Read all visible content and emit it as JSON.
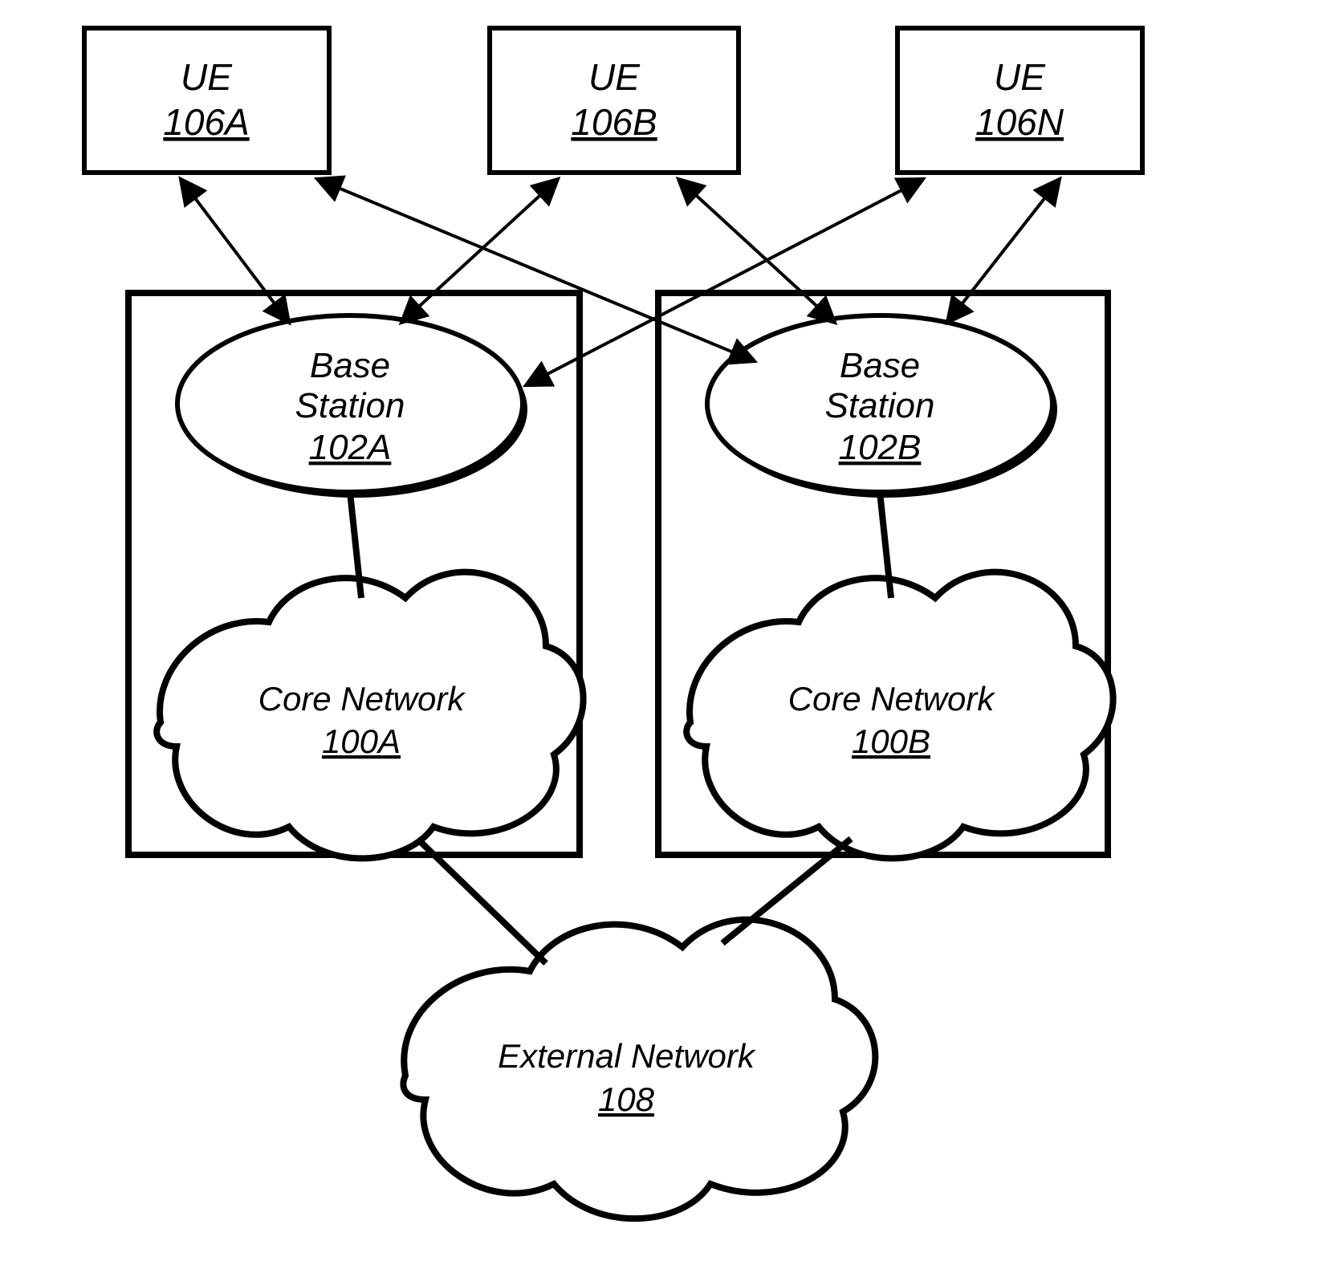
{
  "ue_a": {
    "prefix": "UE",
    "id": "106A"
  },
  "ue_b": {
    "prefix": "UE",
    "id": "106B"
  },
  "ue_n": {
    "prefix": "UE",
    "id": "106N"
  },
  "bs_a": {
    "line1": "Base",
    "line2": "Station",
    "id": "102A"
  },
  "bs_b": {
    "line1": "Base",
    "line2": "Station",
    "id": "102B"
  },
  "cn_a": {
    "label": "Core Network",
    "id": "100A"
  },
  "cn_b": {
    "label": "Core Network",
    "id": "100B"
  },
  "ext": {
    "label": "External Network",
    "id": "108"
  }
}
